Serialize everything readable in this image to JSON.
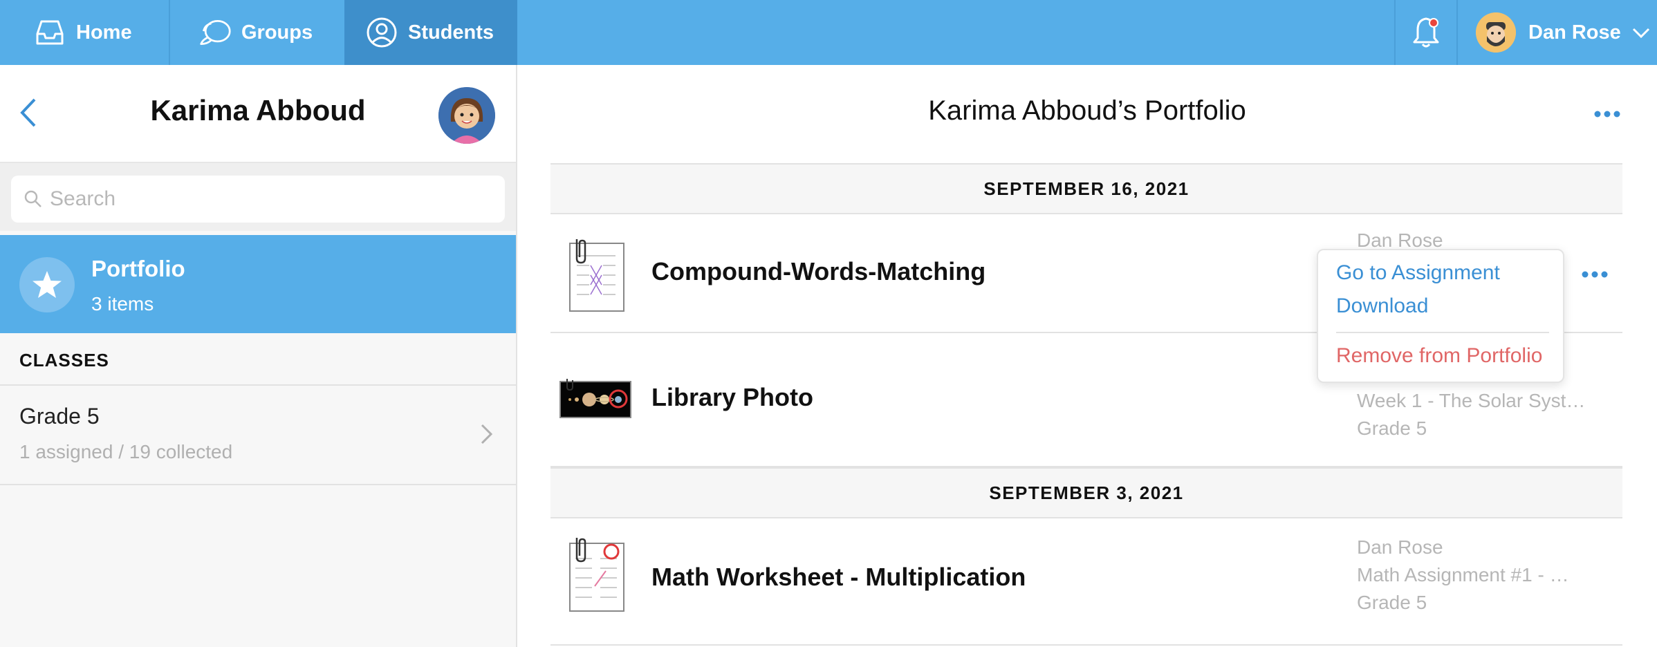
{
  "topbar": {
    "tabs": [
      {
        "label": "Home",
        "icon": "inbox-icon"
      },
      {
        "label": "Groups",
        "icon": "chat-bubbles-icon"
      },
      {
        "label": "Students",
        "icon": "person-icon"
      }
    ],
    "user_name": "Dan Rose",
    "notification_icon": "bell-icon"
  },
  "sidebar": {
    "student_name": "Karima Abboud",
    "search_placeholder": "Search",
    "portfolio": {
      "title": "Portfolio",
      "count": "3 items"
    },
    "classes_header": "CLASSES",
    "classes": [
      {
        "name": "Grade 5",
        "stats": "1 assigned / 19 collected"
      }
    ]
  },
  "main": {
    "title": "Karima Abboud’s Portfolio",
    "groups": [
      {
        "date": "SEPTEMBER 16, 2021",
        "items": [
          {
            "title": "Compound-Words-Matching",
            "meta": [
              "Dan Rose"
            ]
          },
          {
            "title": "Library Photo",
            "meta": [
              "Week 1 - The Solar Syst…",
              "Grade 5"
            ]
          }
        ]
      },
      {
        "date": "SEPTEMBER 3, 2021",
        "items": [
          {
            "title": "Math Worksheet - Multiplication",
            "meta": [
              "Dan Rose",
              "Math Assignment #1 - …",
              "Grade 5"
            ]
          }
        ]
      }
    ]
  },
  "context_menu": {
    "go_to_assignment": "Go to Assignment",
    "download": "Download",
    "remove": "Remove from Portfolio"
  },
  "colors": {
    "brand_blue": "#56aee8",
    "active_tab": "#3e8fcb",
    "link_blue": "#3a8fd4",
    "danger": "#e06666"
  }
}
